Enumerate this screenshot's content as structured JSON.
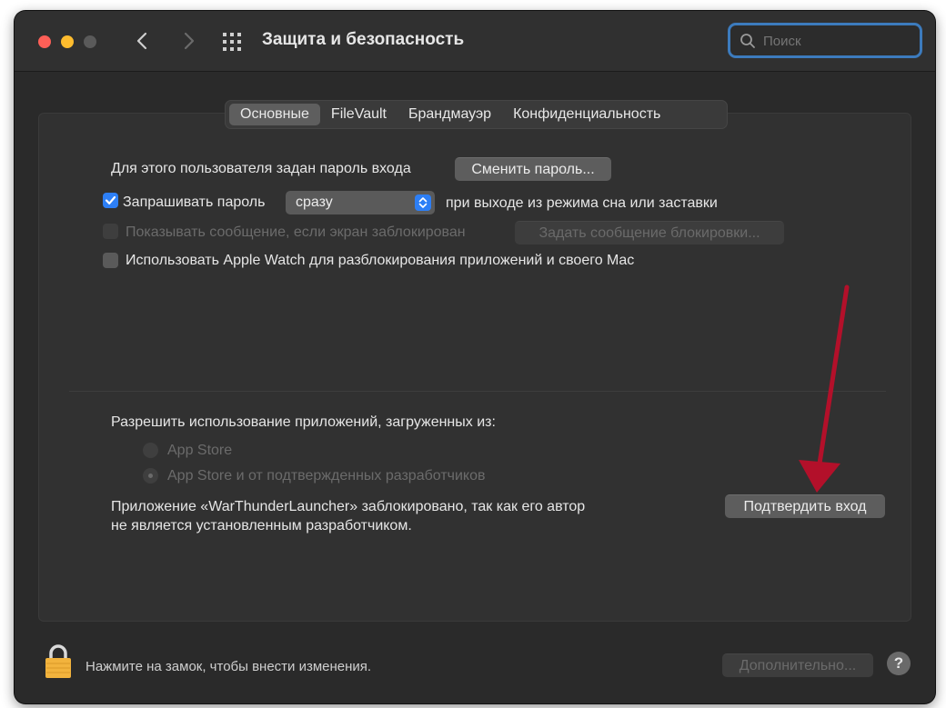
{
  "window": {
    "title": "Защита и безопасность",
    "search_placeholder": "Поиск"
  },
  "tabs": [
    {
      "label": "Основные",
      "active": true
    },
    {
      "label": "FileVault",
      "active": false
    },
    {
      "label": "Брандмауэр",
      "active": false
    },
    {
      "label": "Конфиденциальность",
      "active": false
    }
  ],
  "general": {
    "password_set_label": "Для этого пользователя задан пароль входа",
    "change_password_button": "Сменить пароль...",
    "require_password": {
      "label": "Запрашивать пароль",
      "checked": true,
      "delay_value": "сразу",
      "suffix": "при выходе из режима сна или заставки"
    },
    "show_message": {
      "label": "Показывать сообщение, если экран заблокирован",
      "checked": false,
      "enabled": false,
      "button": "Задать сообщение блокировки..."
    },
    "apple_watch": {
      "label": "Использовать Apple Watch для разблокирования приложений и своего Mac",
      "checked": false
    }
  },
  "apps": {
    "heading": "Разрешить использование приложений, загруженных из:",
    "options": [
      {
        "label": "App Store",
        "selected": false
      },
      {
        "label": "App Store и от подтвержденных разработчиков",
        "selected": true
      }
    ],
    "blocked_message_line1": "Приложение «WarThunderLauncher» заблокировано, так как его автор",
    "blocked_message_line2": "не является установленным разработчиком.",
    "confirm_button": "Подтвердить вход"
  },
  "footer": {
    "lock_hint": "Нажмите на замок, чтобы внести изменения.",
    "advanced_button": "Дополнительно...",
    "help_label": "?"
  },
  "colors": {
    "accent": "#2d7ff6",
    "search_focus": "#3c7bbd",
    "annotation_arrow": "#b3102a",
    "lock": "#f2b33d"
  },
  "icons": [
    "back-chevron-icon",
    "forward-chevron-icon",
    "grid-icon",
    "search-icon",
    "lock-icon",
    "checkmark-icon",
    "updown-arrows-icon"
  ]
}
